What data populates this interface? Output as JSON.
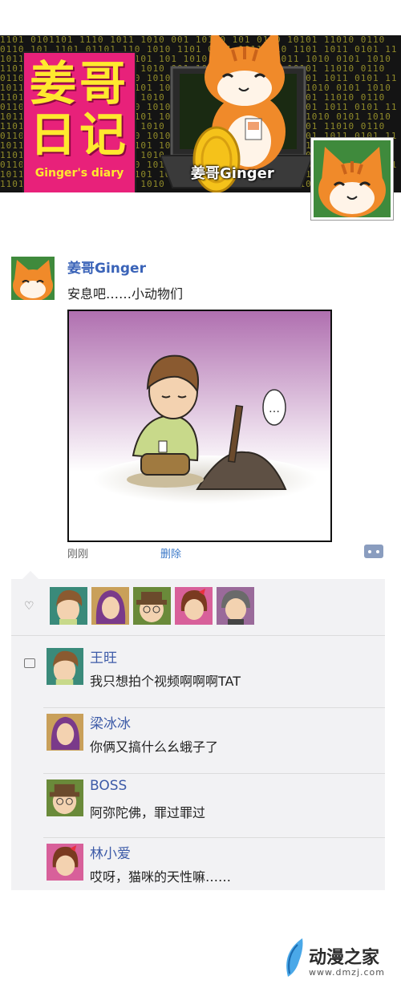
{
  "banner": {
    "logo_title": "姜哥\n日记",
    "logo_line1": "姜哥",
    "logo_line2": "日记",
    "logo_subtitle": "Ginger's diary",
    "name": "姜哥Ginger",
    "matrix_text": "1101 0101101 1110 1011 1010 001 10110 101 0110 10101 11010 0110\n0110 101 1101 01101 110 1010 1101 0101 1011 010 1101 1011 0101 11\n1011 0110 1011 1010 01101 101 1010 1101 0110 1011 1010 0101 1010\n1101 0101101 1110 1011 1010 001 10110 101 0110 10101 11010 0110\n0110 101 1101 01101 110 1010 1101 0101 1011 010 1101 1011 0101 11\n1011 0110 1011 1010 01101 101 1010 1101 0110 1011 1010 0101 1010\n1101 0101101 1110 1011 1010 001 10110 101 0110 10101 11010 0110\n0110 101 1101 01101 110 1010 1101 0101 1011 010 1101 1011 0101 11\n1011 0110 1011 1010 01101 101 1010 1101 0110 1011 1010 0101 1010\n1101 0101101 1110 1011 1010 001 10110 101 0110 10101 11010 0110\n0110 101 1101 01101 110 1010 1101 0101 1011 010 1101 1011 0101 11\n1011 0110 1011 1010 01101 101 1010 1101 0110 1011 1010 0101 1010\n1101 0101101 1110 1011 1010 001 10110 101 0110 10101 11010 0110\n0110 101 1101 01101 110 1010 1101 0101 1011 010 1101 1011 0101 11\n1011 0110 1011 1010 01101 101 1010 1101 0110 1011 1010 0101 1010\n1101 0101101 1110 1011 1010 001 10110 101 0110 10101 11010 0110"
  },
  "post": {
    "author": "姜哥Ginger",
    "text": "安息吧……小动物们",
    "speech": "…",
    "time": "刚刚",
    "delete_label": "删除"
  },
  "likes": {
    "icon": "heart-icon",
    "users": [
      "wang-wang",
      "liang-bingbing",
      "boss",
      "lin-xiaoai",
      "grandma"
    ]
  },
  "comments": [
    {
      "name": "王旺",
      "text": "我只想拍个视频啊啊啊TAT",
      "avatar": "wang-wang"
    },
    {
      "name": "梁冰冰",
      "text": "你俩又搞什么幺蛾子了",
      "avatar": "liang-bingbing"
    },
    {
      "name": "BOSS",
      "text": "阿弥陀佛，罪过罪过",
      "avatar": "boss"
    },
    {
      "name": "林小爱",
      "text": "哎呀，猫咪的天性嘛……",
      "avatar": "lin-xiaoai"
    }
  ],
  "site": {
    "name": "动漫之家",
    "url": "www.dmzj.com"
  },
  "colors": {
    "logo_bg": "#e8217a",
    "logo_text": "#ffe92e",
    "link": "#3a63b8",
    "panel_bg": "#f2f2f4"
  }
}
